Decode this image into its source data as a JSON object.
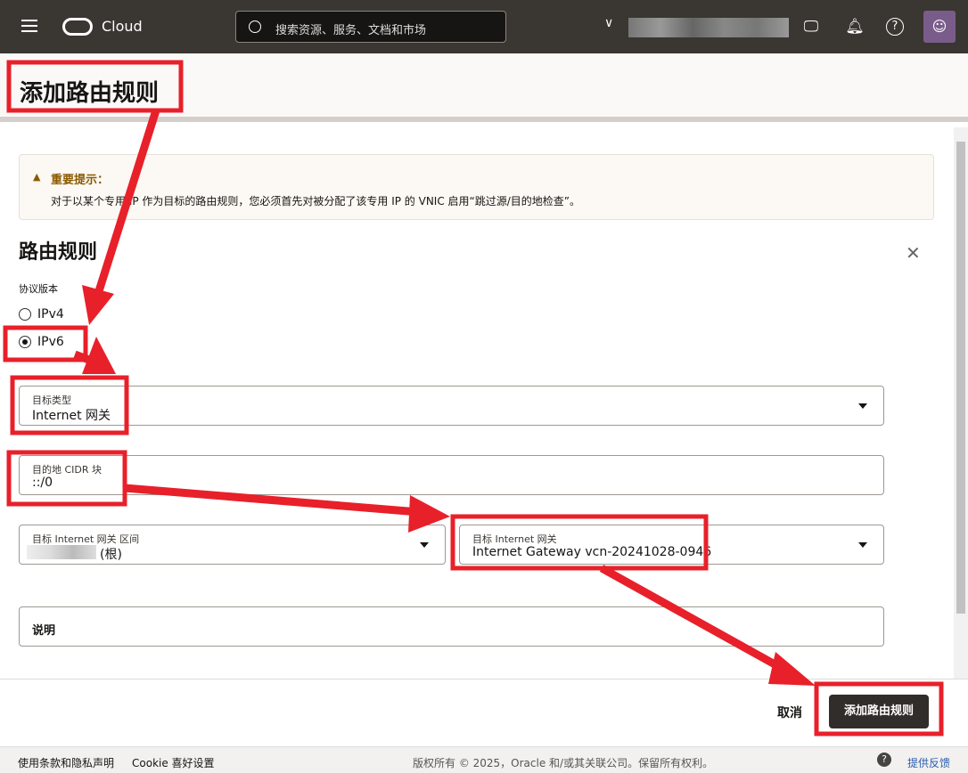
{
  "header": {
    "brand": "Cloud",
    "search_placeholder": "搜索资源、服务、文档和市场"
  },
  "page": {
    "title": "添加路由规则"
  },
  "notice": {
    "title": "重要提示：",
    "text": "对于以某个专用 IP 作为目标的路由规则，您必须首先对被分配了该专用 IP 的 VNIC 启用“跳过源/目的地检查”。"
  },
  "form": {
    "section_title": "路由规则",
    "protocol_label": "协议版本",
    "options": [
      "IPv4",
      "IPv6"
    ],
    "selected": "IPv6",
    "target_type": {
      "label": "目标类型",
      "value": "Internet 网关"
    },
    "cidr": {
      "label": "目的地 CIDR 块",
      "value": "::/0"
    },
    "compartment": {
      "label": "目标 Internet 网关 区间",
      "value": "(根)"
    },
    "gateway": {
      "label": "目标 Internet 网关",
      "value": "Internet Gateway vcn-20241028-0946"
    },
    "description": {
      "label": "说明"
    }
  },
  "actions": {
    "cancel": "取消",
    "submit": "添加路由规则"
  },
  "footer": {
    "terms": "使用条款和隐私声明",
    "cookie": "Cookie 喜好设置",
    "copyright": "版权所有 © 2025，Oracle 和/或其关联公司。保留所有权利。",
    "feedback": "提供反馈"
  },
  "colors": {
    "annotation": "#e8202a",
    "header": "#3a3632",
    "notice_title": "#8a5a00"
  }
}
